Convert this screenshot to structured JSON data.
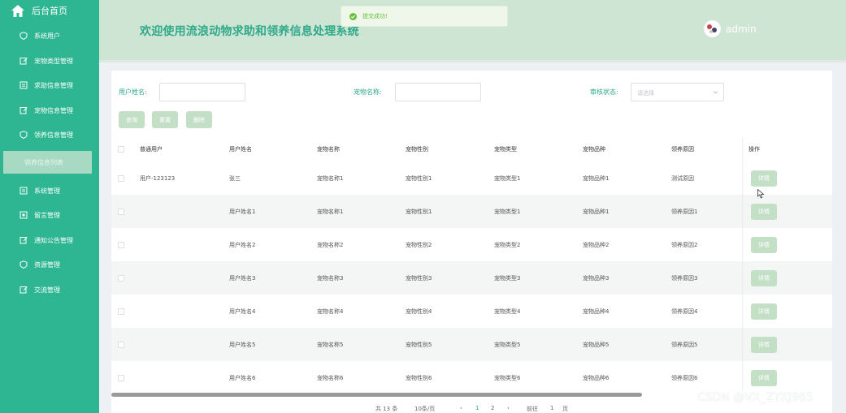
{
  "sidebar": {
    "brand": "后台首页",
    "items": [
      {
        "label": "系统用户",
        "icon": "shield-icon"
      },
      {
        "label": "宠物类型管理",
        "icon": "edit-icon"
      },
      {
        "label": "求助信息管理",
        "icon": "list-icon"
      },
      {
        "label": "宠物信息管理",
        "icon": "edit-icon"
      },
      {
        "label": "领养信息管理",
        "icon": "shield-icon"
      },
      {
        "label": "领养信息列表",
        "icon": "",
        "active": true
      },
      {
        "label": "系统管理",
        "icon": "list-icon"
      },
      {
        "label": "留言管理",
        "icon": "box-icon"
      },
      {
        "label": "通知公告管理",
        "icon": "edit-icon"
      },
      {
        "label": "资源管理",
        "icon": "shield-icon"
      },
      {
        "label": "交流管理",
        "icon": "edit-icon"
      }
    ]
  },
  "header": {
    "title": "欢迎使用流浪动物求助和领养信息处理系统",
    "toast": "提交成功!",
    "username": "admin"
  },
  "search": {
    "user_label": "用户姓名:",
    "pet_label": "宠物名称:",
    "status_label": "审核状态:",
    "status_placeholder": "请选择",
    "query_btn": "查询",
    "reset_btn": "重置",
    "delete_btn": "删除"
  },
  "table": {
    "columns": [
      "普通用户",
      "用户姓名",
      "宠物名称",
      "宠物性别",
      "宠物类型",
      "宠物品种",
      "领养原因",
      "操作"
    ],
    "rows": [
      [
        "用户-123123",
        "张三",
        "宠物名称1",
        "宠物性别1",
        "宠物类型1",
        "宠物品种1",
        "测试原因"
      ],
      [
        "",
        "用户姓名1",
        "宠物名称1",
        "宠物性别1",
        "宠物类型1",
        "宠物品种1",
        "领养原因1"
      ],
      [
        "",
        "用户姓名2",
        "宠物名称2",
        "宠物性别2",
        "宠物类型2",
        "宠物品种2",
        "领养原因2"
      ],
      [
        "",
        "用户姓名3",
        "宠物名称3",
        "宠物性别3",
        "宠物类型3",
        "宠物品种3",
        "领养原因3"
      ],
      [
        "",
        "用户姓名4",
        "宠物名称4",
        "宠物性别4",
        "宠物类型4",
        "宠物品种4",
        "领养原因4"
      ],
      [
        "",
        "用户姓名5",
        "宠物名称5",
        "宠物性别5",
        "宠物类型5",
        "宠物品种5",
        "领养原因5"
      ],
      [
        "",
        "用户姓名6",
        "宠物名称6",
        "宠物性别6",
        "宠物类型6",
        "宠物品种6",
        "领养原因6"
      ]
    ],
    "detail_label": "详情"
  },
  "pagination": {
    "total": "共 13 条",
    "page_size": "10条/页",
    "pages": [
      "1",
      "2"
    ],
    "goto_prefix": "前往",
    "goto_value": "1",
    "goto_suffix": "页"
  },
  "watermark": "CSDN @VX_ZYKJ985",
  "colors": {
    "sidebar": "#2eb591",
    "header": "#cfe5d3",
    "accent_text": "#2fa98a",
    "button": "#c3e0c7",
    "success": "#67c23a"
  }
}
